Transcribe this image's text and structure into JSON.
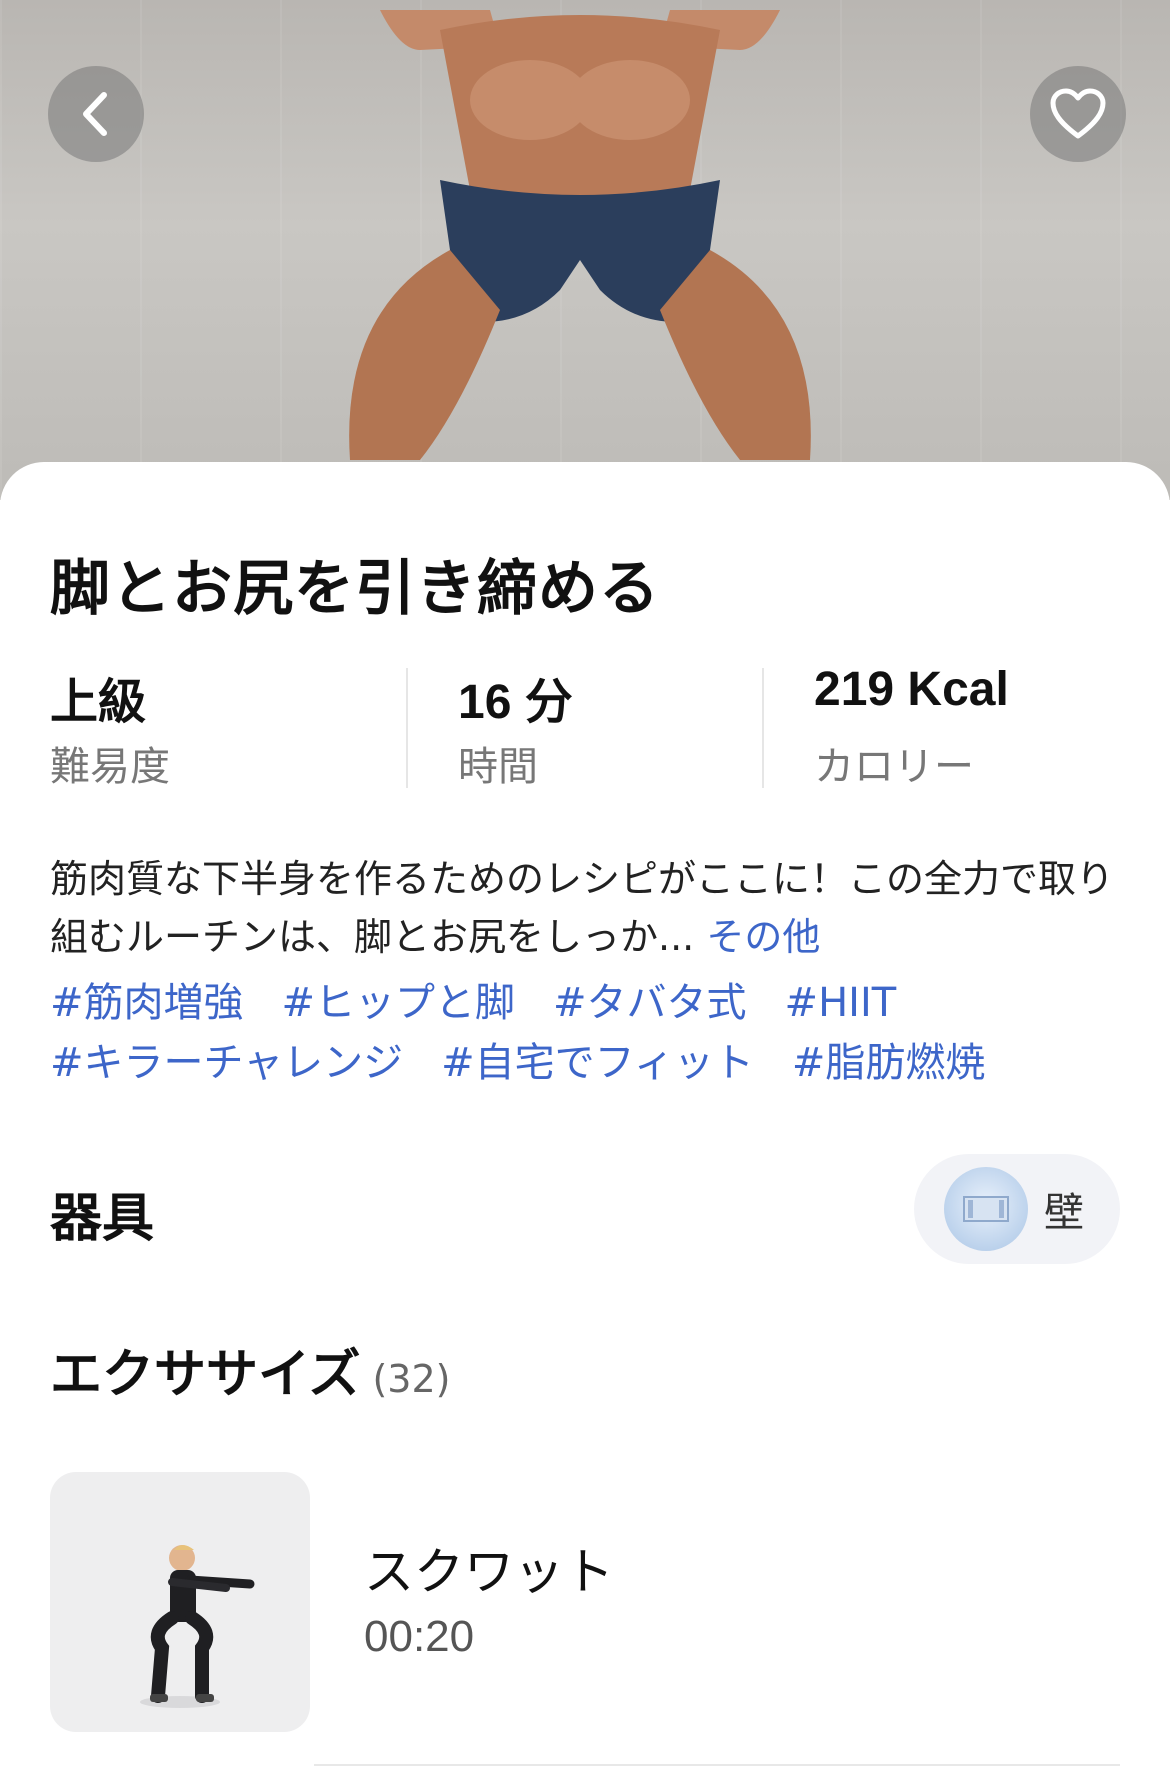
{
  "hero": {
    "back_icon": "chevron-left-icon",
    "favorite_icon": "heart-outline-icon"
  },
  "workout": {
    "title": "脚とお尻を引き締める",
    "stats": [
      {
        "value": "上級",
        "label": "難易度"
      },
      {
        "value": "16 分",
        "label": "時間"
      },
      {
        "value": "219 Kcal",
        "label": "カロリー"
      }
    ],
    "description": "筋肉質な下半身を作るためのレシピがここに！この全力で取り組むルーチンは、脚とお尻をしっか...",
    "more_label": "その他",
    "tags": [
      "#筋肉増強",
      "#ヒップと脚",
      "#タバタ式",
      "#HIIT",
      "#キラーチャレンジ",
      "#自宅でフィット",
      "#脂肪燃焼"
    ]
  },
  "equipment": {
    "heading": "器具",
    "items": [
      {
        "label": "壁",
        "icon": "wall-icon"
      }
    ]
  },
  "exercises": {
    "heading": "エクササイズ",
    "count": "(32)",
    "items": [
      {
        "name": "スクワット",
        "duration": "00:20"
      }
    ]
  },
  "colors": {
    "link": "#3d66c9",
    "muted": "#777777",
    "pill_bg": "#f2f3f7"
  }
}
